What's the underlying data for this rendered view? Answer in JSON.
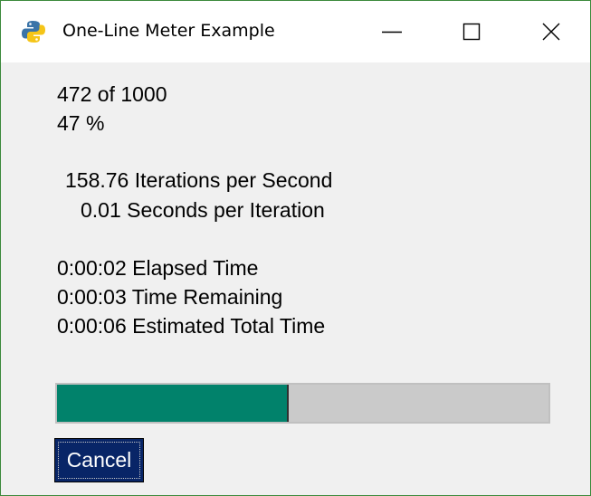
{
  "window": {
    "title": "One-Line Meter Example",
    "icon": "python-icon",
    "controls": [
      "minimize-icon",
      "maximize-icon",
      "close-icon"
    ]
  },
  "meter": {
    "count_line": "472 of 1000",
    "percent_line": "47 %",
    "rate_line": "158.76 Iterations per Second",
    "seconds_line": "0.01 Seconds per Iteration",
    "elapsed_line": "0:00:02 Elapsed Time",
    "remaining_line": "0:00:03 Time Remaining",
    "total_line": "0:00:06 Estimated Total Time"
  },
  "progress": {
    "current": 472,
    "max": 1000,
    "fill_color": "#01826b",
    "track_color": "#cacaca"
  },
  "cancel_button": {
    "label": "Cancel",
    "color": "#082567"
  }
}
